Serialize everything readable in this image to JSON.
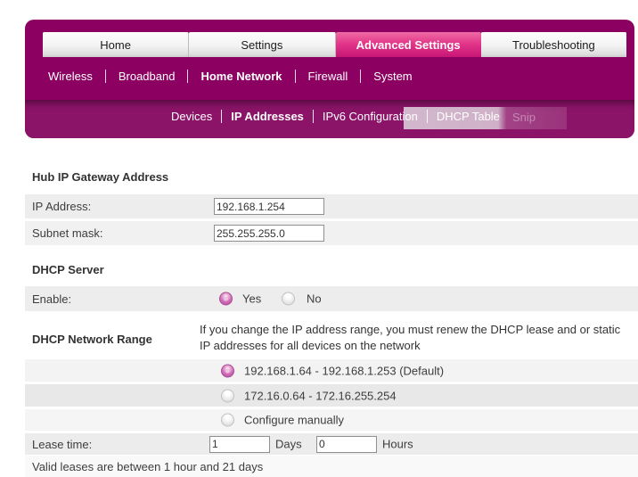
{
  "colors": {
    "panel_magenta": "#8b0061",
    "band_magenta": "#8c1468",
    "active_tab_pink": "#e23488",
    "row_gray": "#ededed",
    "radio_pink": "#cd68b6"
  },
  "nav": {
    "tabs": [
      {
        "label": "Home"
      },
      {
        "label": "Settings"
      },
      {
        "label": "Advanced Settings"
      },
      {
        "label": "Troubleshooting"
      }
    ],
    "active_tab": "Advanced Settings",
    "subnav": [
      {
        "label": "Wireless"
      },
      {
        "label": "Broadband"
      },
      {
        "label": "Home Network"
      },
      {
        "label": "Firewall"
      },
      {
        "label": "System"
      }
    ],
    "active_subnav": "Home Network",
    "sectionnav": [
      {
        "label": "Devices"
      },
      {
        "label": "IP Addresses"
      },
      {
        "label": "IPv6 Configuration"
      },
      {
        "label": "DHCP Table"
      }
    ],
    "active_sectionnav": "IP Addresses",
    "snip_label": "Snip"
  },
  "gateway": {
    "title": "Hub IP Gateway Address",
    "ip_label": "IP Address:",
    "ip_value": "192.168.1.254",
    "subnet_label": "Subnet mask:",
    "subnet_value": "255.255.255.0"
  },
  "dhcp_server": {
    "title": "DHCP Server",
    "enable_label": "Enable:",
    "yes_label": "Yes",
    "no_label": "No",
    "enabled": "Yes"
  },
  "dhcp_range": {
    "title": "DHCP Network Range",
    "description": "If you change the IP address range, you must renew the DHCP lease and or static IP addresses for all devices on the network",
    "options": [
      {
        "label": "192.168.1.64 - 192.168.1.253 (Default)",
        "selected": true
      },
      {
        "label": "172.16.0.64 - 172.16.255.254",
        "selected": false
      },
      {
        "label": "Configure manually",
        "selected": false
      }
    ],
    "lease_label": "Lease time:",
    "lease_days_value": "1",
    "days_label": "Days",
    "lease_hours_value": "0",
    "hours_label": "Hours",
    "note": "Valid leases are between 1 hour and 21 days"
  }
}
